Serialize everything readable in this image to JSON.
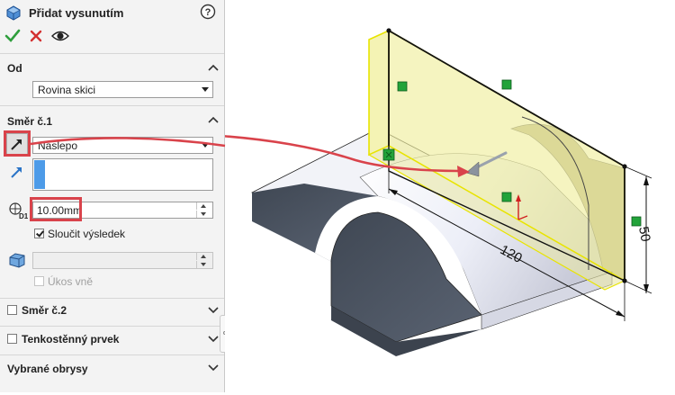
{
  "panel": {
    "title": "Přidat vysunutím",
    "help_icon": "help-icon",
    "ok_icon": "checkmark-icon",
    "cancel_icon": "close-icon",
    "preview_icon": "eye-icon",
    "from_section": {
      "title": "Od",
      "start_condition": "Rovina skici"
    },
    "direction1_section": {
      "title": "Směr č.1",
      "end_condition": "Naslepo",
      "depth": "10.00mm",
      "merge_result_label": "Sloučit výsledek",
      "merge_result_checked": true,
      "draft_outward_label": "Úkos vně",
      "draft_outward_checked": false
    },
    "direction2_section": {
      "title": "Směr č.2",
      "checked": false
    },
    "thin_feature_section": {
      "title": "Tenkostěnný prvek",
      "checked": false
    },
    "selected_contours_section": {
      "title": "Vybrané obrysy"
    }
  },
  "viewport": {
    "dimensions": {
      "length": "120",
      "height": "50"
    },
    "colors": {
      "callout_red": "#d9434b",
      "sketch_preview_yellow": "#f0ee9e",
      "part_face": "#e6e8f2",
      "part_dark": "#4c5563",
      "relation_green": "#22a33a"
    }
  }
}
